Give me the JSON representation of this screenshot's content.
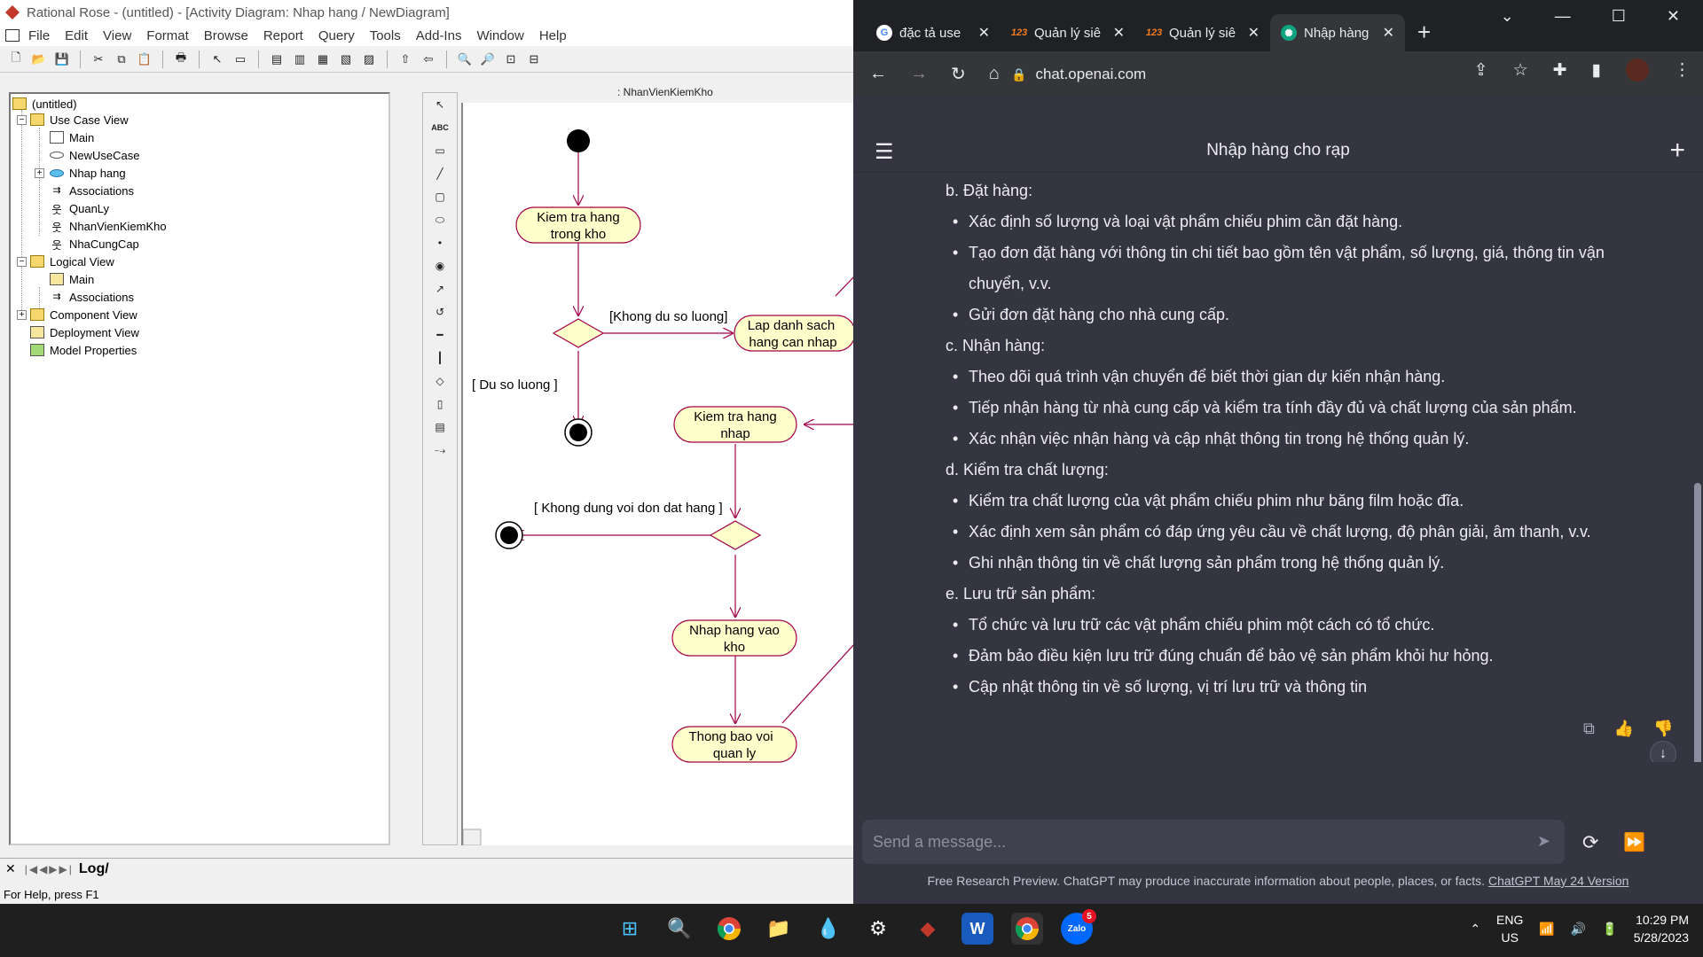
{
  "rose": {
    "title": "Rational Rose - (untitled) - [Activity Diagram: Nhap hang / NewDiagram]",
    "menu": [
      "File",
      "Edit",
      "View",
      "Format",
      "Browse",
      "Report",
      "Query",
      "Tools",
      "Add-Ins",
      "Window",
      "Help"
    ],
    "tree": {
      "root": "(untitled)",
      "use_case_view": "Use Case View",
      "uc_main": "Main",
      "uc_newusecase": "NewUseCase",
      "uc_nhaphang": "Nhap hang",
      "uc_associations": "Associations",
      "uc_quanly": "QuanLy",
      "uc_nhanvien": "NhanVienKiemKho",
      "uc_nhacungcap": "NhaCungCap",
      "logical_view": "Logical View",
      "lv_main": "Main",
      "lv_associations": "Associations",
      "component_view": "Component View",
      "deployment_view": "Deployment View",
      "model_properties": "Model Properties"
    },
    "swimlane": ": NhanVienKiemKho",
    "diagram": {
      "act1": [
        "Kiem tra hang",
        "trong kho"
      ],
      "act2": [
        "Lap danh sach",
        "hang can nhap"
      ],
      "act3": [
        "Kiem tra hang",
        "nhap"
      ],
      "act4": [
        "Nhap hang vao",
        "kho"
      ],
      "act5": [
        "Thong bao voi",
        "quan ly"
      ],
      "guard1": "[Khong du so luong]",
      "guard2": "[ Du so luong ]",
      "guard3": "[ Khong dung voi don dat hang ]"
    },
    "log_tab": "Log/",
    "status": "For Help, press F1"
  },
  "chrome": {
    "tabs": [
      {
        "title": "đặc tả use",
        "icon": "G"
      },
      {
        "title": "Quản lý siê",
        "icon": "123"
      },
      {
        "title": "Quản lý siê",
        "icon": "123"
      },
      {
        "title": "Nhập hàng",
        "icon": "gpt"
      }
    ],
    "url": "chat.openai.com",
    "conversation_title": "Nhập hàng cho rạp",
    "lines": [
      {
        "t": "h",
        "text": "b. Đặt hàng:"
      },
      {
        "t": "b",
        "text": "Xác định số lượng và loại vật phẩm chiếu phim cần đặt hàng."
      },
      {
        "t": "b",
        "text": "Tạo đơn đặt hàng với thông tin chi tiết bao gồm tên vật phẩm, số lượng, giá, thông tin vận chuyển, v.v."
      },
      {
        "t": "b",
        "text": "Gửi đơn đặt hàng cho nhà cung cấp."
      },
      {
        "t": "h",
        "text": "c. Nhận hàng:"
      },
      {
        "t": "b",
        "text": "Theo dõi quá trình vận chuyển để biết thời gian dự kiến nhận hàng."
      },
      {
        "t": "b",
        "text": "Tiếp nhận hàng từ nhà cung cấp và kiểm tra tính đầy đủ và chất lượng của sản phẩm."
      },
      {
        "t": "b",
        "text": "Xác nhận việc nhận hàng và cập nhật thông tin trong hệ thống quản lý."
      },
      {
        "t": "h",
        "text": "d. Kiểm tra chất lượng:"
      },
      {
        "t": "b",
        "text": "Kiểm tra chất lượng của vật phẩm chiếu phim như băng film hoặc đĩa."
      },
      {
        "t": "b",
        "text": "Xác định xem sản phẩm có đáp ứng yêu cầu về chất lượng, độ phân giải, âm thanh, v.v."
      },
      {
        "t": "b",
        "text": "Ghi nhận thông tin về chất lượng sản phẩm trong hệ thống quản lý."
      },
      {
        "t": "h",
        "text": "e. Lưu trữ sản phẩm:"
      },
      {
        "t": "b",
        "text": "Tổ chức và lưu trữ các vật phẩm chiếu phim một cách có tổ chức."
      },
      {
        "t": "b",
        "text": "Đảm bảo điều kiện lưu trữ đúng chuẩn để bảo vệ sản phẩm khỏi hư hỏng."
      },
      {
        "t": "b",
        "text": "Cập nhật thông tin về số lượng, vị trí lưu trữ và thông tin"
      }
    ],
    "input_placeholder": "Send a message...",
    "footer_text": "Free Research Preview. ChatGPT may produce inaccurate information about people, places, or facts. ",
    "footer_link": "ChatGPT May 24 Version"
  },
  "taskbar": {
    "lang": "ENG",
    "region": "US",
    "time": "10:29 PM",
    "date": "5/28/2023",
    "zalo_badge": "5"
  }
}
